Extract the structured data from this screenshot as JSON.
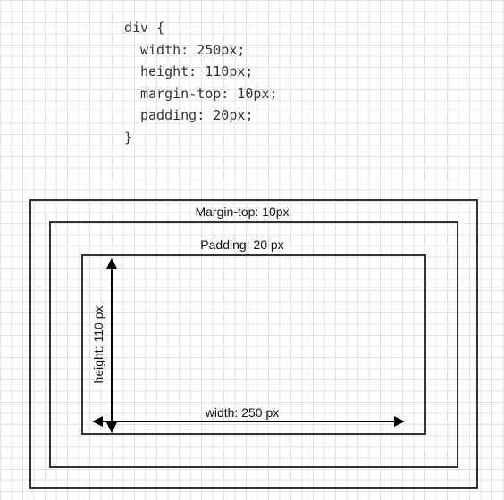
{
  "code": {
    "line1": "div {",
    "line2": "width: 250px;",
    "line3": "height: 110px;",
    "line4": "margin-top: 10px;",
    "line5": "padding: 20px;",
    "line6": "}"
  },
  "labels": {
    "margin": "Margin-top: 10px",
    "padding": "Padding: 20 px",
    "height": "height: 110 px",
    "width": "width: 250 px"
  }
}
